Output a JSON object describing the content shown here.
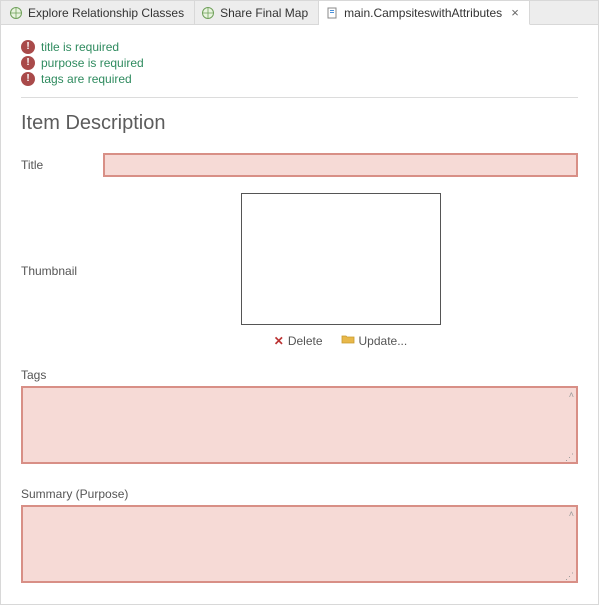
{
  "tabs": [
    {
      "label": "Explore Relationship Classes",
      "icon": "globe-icon",
      "active": false
    },
    {
      "label": "Share Final Map",
      "icon": "globe-icon",
      "active": false
    },
    {
      "label": "main.CampsiteswithAttributes",
      "icon": "file-icon",
      "active": true,
      "closable": true
    }
  ],
  "warnings": [
    "title is required",
    "purpose is required",
    "tags are required"
  ],
  "heading": "Item Description",
  "fields": {
    "title_label": "Title",
    "title_value": "",
    "thumbnail_label": "Thumbnail",
    "delete_label": "Delete",
    "update_label": "Update...",
    "tags_label": "Tags",
    "tags_value": "",
    "summary_label": "Summary (Purpose)",
    "summary_value": ""
  }
}
